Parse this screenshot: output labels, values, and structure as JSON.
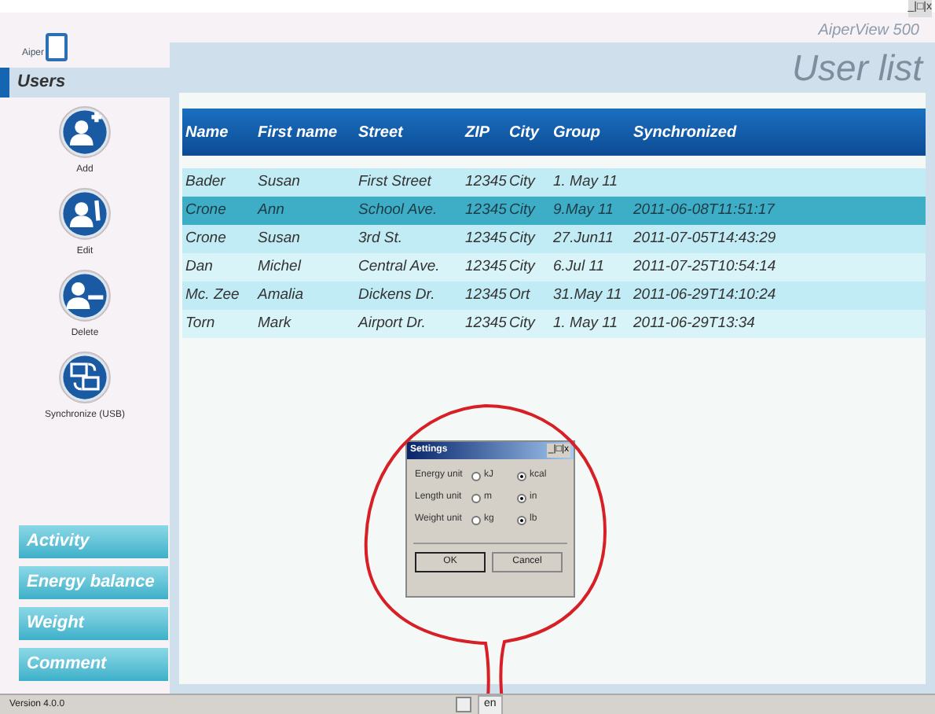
{
  "app": {
    "logo": "Aiper",
    "product": "AiperView 500",
    "window_controls": "_|□|x"
  },
  "sidebar": {
    "heading": "Users",
    "actions": [
      {
        "kind": "add",
        "label": "Add"
      },
      {
        "kind": "edit",
        "label": "Edit"
      },
      {
        "kind": "delete",
        "label": "Delete"
      },
      {
        "kind": "sync",
        "label": "Synchronize (USB)"
      }
    ],
    "nav": [
      "Activity",
      "Energy balance",
      "Weight",
      "Comment"
    ]
  },
  "page_title": "User list",
  "table": {
    "columns": [
      "Name",
      "First name",
      "Street",
      "ZIP",
      "City",
      "Group",
      "Synchronized"
    ],
    "rows": [
      {
        "cells": [
          "Bader",
          "Susan",
          "First Street",
          "12345",
          "City",
          "1. May 11",
          ""
        ],
        "selected": false
      },
      {
        "cells": [
          "Crone",
          "Ann",
          "School Ave.",
          "12345",
          "City",
          "9.May 11",
          "2011-06-08T11:51:17"
        ],
        "selected": true
      },
      {
        "cells": [
          "Crone",
          "Susan",
          "3rd St.",
          "12345",
          "City",
          "27.Jun11",
          "2011-07-05T14:43:29"
        ],
        "selected": false
      },
      {
        "cells": [
          "Dan",
          "Michel",
          "Central Ave.",
          "12345",
          "City",
          "6.Jul 11",
          "2011-07-25T10:54:14"
        ],
        "selected": false
      },
      {
        "cells": [
          "Mc. Zee",
          "Amalia",
          "Dickens Dr.",
          "12345",
          "Ort",
          "31.May 11",
          "2011-06-29T14:10:24"
        ],
        "selected": false
      },
      {
        "cells": [
          "Torn",
          "Mark",
          "Airport Dr.",
          "12345",
          "City",
          "1. May 11",
          "2011-06-29T13:34"
        ],
        "selected": false
      }
    ]
  },
  "settings_dialog": {
    "title": "Settings",
    "controls": "_|□|x",
    "units": [
      {
        "label": "Energy unit",
        "options": [
          {
            "label": "kJ",
            "selected": false
          },
          {
            "label": "kcal",
            "selected": true
          }
        ]
      },
      {
        "label": "Length unit",
        "options": [
          {
            "label": "m",
            "selected": false
          },
          {
            "label": "in",
            "selected": true
          }
        ]
      },
      {
        "label": "Weight unit",
        "options": [
          {
            "label": "kg",
            "selected": false
          },
          {
            "label": "lb",
            "selected": true
          }
        ]
      }
    ],
    "buttons": [
      "OK",
      "Cancel"
    ]
  },
  "status_bar": {
    "version": "Version 4.0.0",
    "language": "en"
  }
}
